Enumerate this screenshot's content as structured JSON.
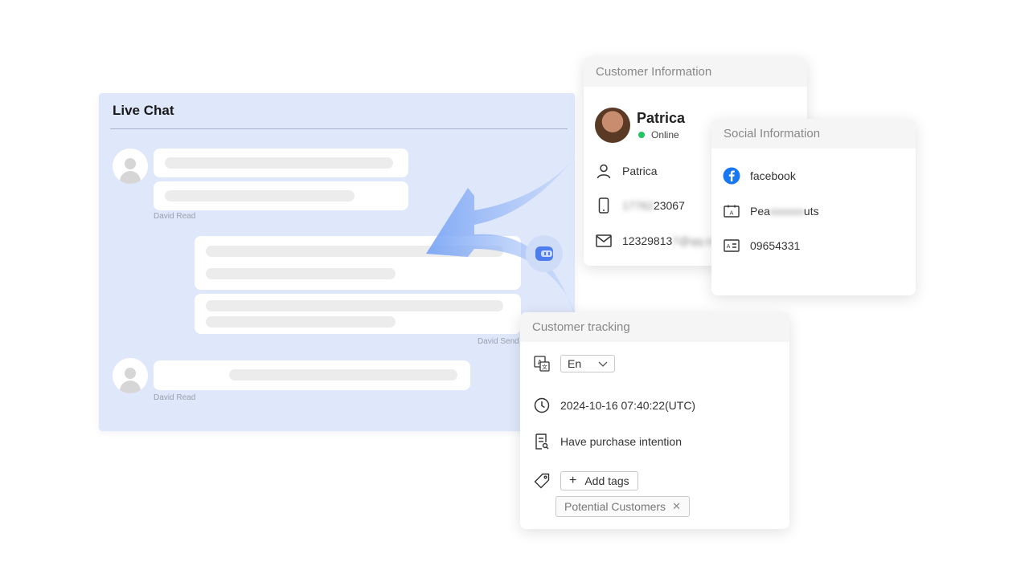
{
  "live_chat": {
    "title": "Live Chat",
    "messages": [
      {
        "sender": "David Read"
      },
      {
        "sender": "David Send"
      },
      {
        "sender": "David Read"
      }
    ]
  },
  "customer_info": {
    "header": "Customer Information",
    "name": "Patrica",
    "status": "Online",
    "status_color": "#22c55e",
    "contact_name": "Patrica",
    "phone_blurred": "17762",
    "phone_visible": "23067",
    "email_visible": "12329813",
    "email_blurred": "7@qq.co"
  },
  "social_info": {
    "header": "Social Information",
    "platform": "facebook",
    "platform_color": "#1877f2",
    "account_prefix": "Pea",
    "account_blurred": "xxxxxx",
    "account_suffix": "uts",
    "id_number": "09654331"
  },
  "customer_tracking": {
    "header": "Customer tracking",
    "language": "En",
    "timestamp": "2024-10-16 07:40:22(UTC)",
    "intention": "Have purchase intention",
    "add_tags_label": "Add tags",
    "tags": [
      "Potential Customers"
    ]
  },
  "colors": {
    "chat_bg": "#dfe7fb",
    "accent": "#4e7df0"
  },
  "icons": {
    "bot": "bot-icon",
    "language": "translate-icon",
    "clock": "clock-icon",
    "intention": "document-icon",
    "tag": "tag-icon"
  }
}
